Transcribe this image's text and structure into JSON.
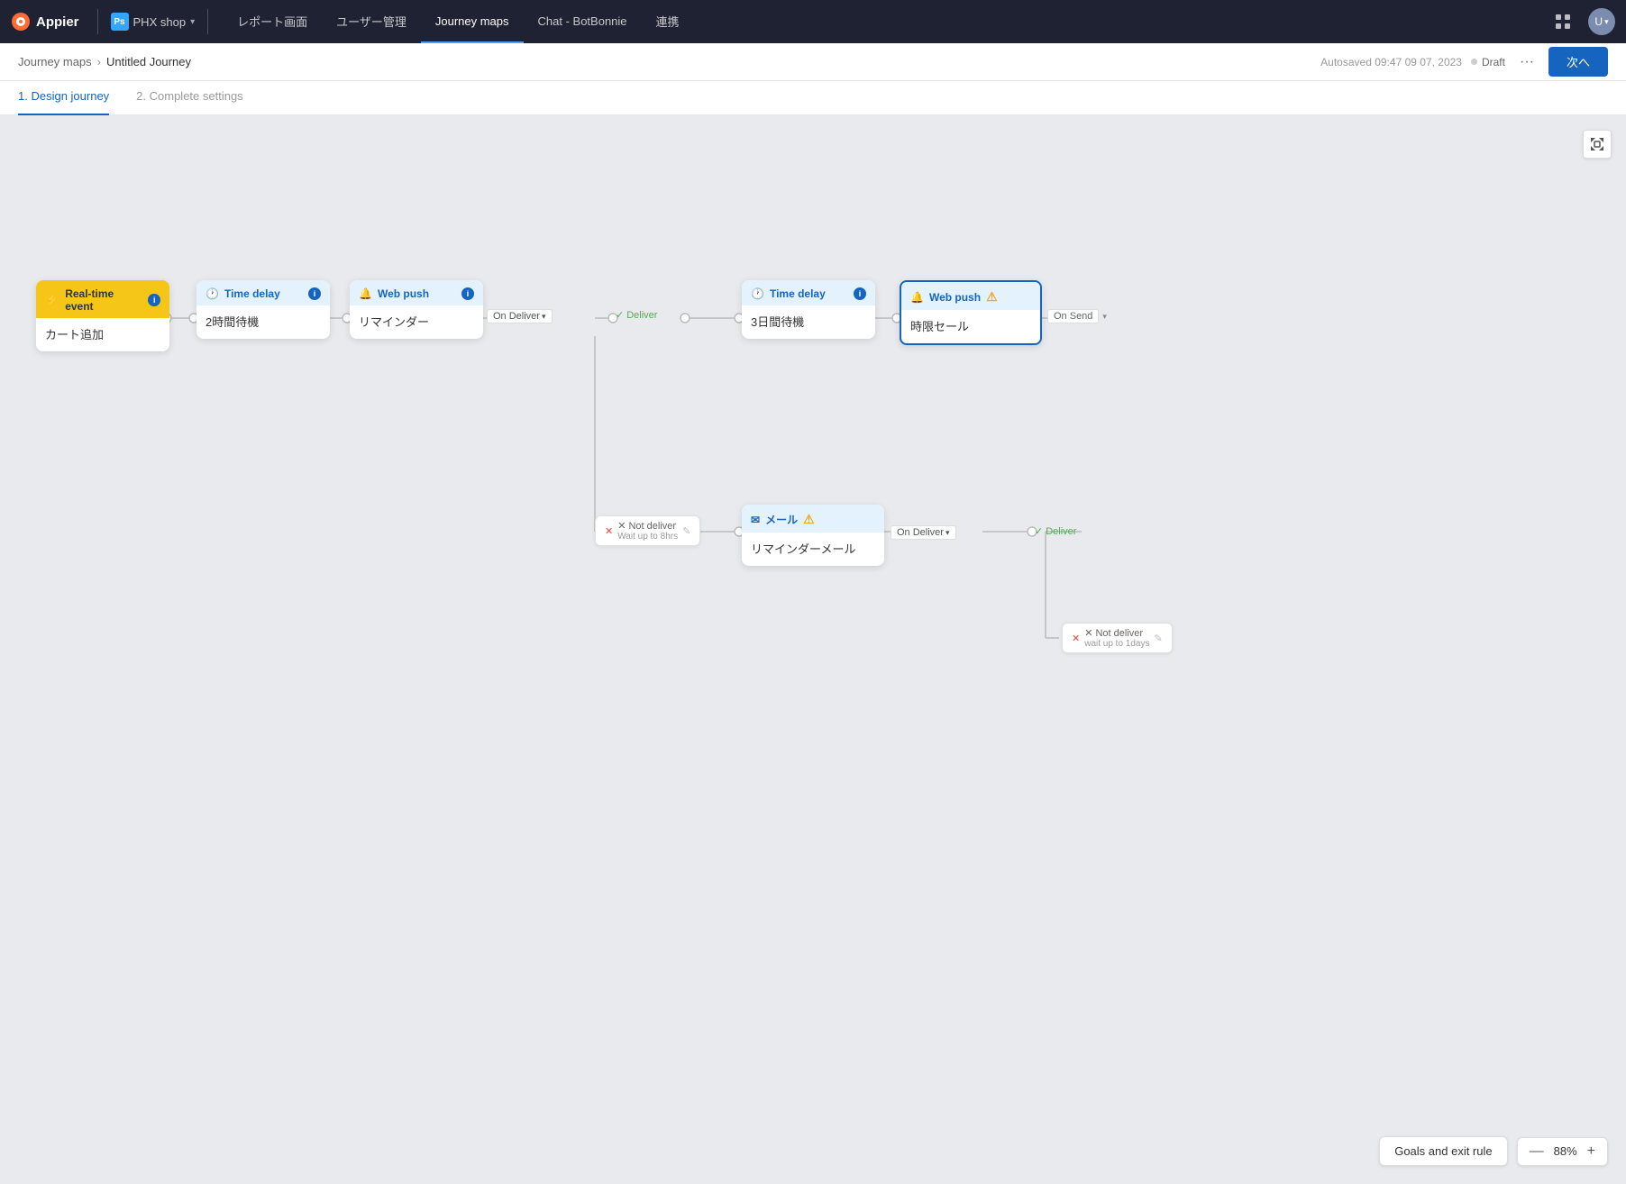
{
  "app": {
    "logo_text": "Appier",
    "workspace": "PHX shop",
    "nav_items": [
      {
        "label": "レポート画面",
        "active": false
      },
      {
        "label": "ユーザー管理",
        "active": false
      },
      {
        "label": "Journey maps",
        "active": true
      },
      {
        "label": "Chat - BotBonnie",
        "active": false
      },
      {
        "label": "連携",
        "active": false
      }
    ]
  },
  "header": {
    "breadcrumb_parent": "Journey maps",
    "breadcrumb_current": "Untitled Journey",
    "status_label": "Draft",
    "autosaved": "Autosaved  09:47 09 07, 2023",
    "next_btn": "次へ"
  },
  "steps": [
    {
      "label": "1. Design journey",
      "active": true
    },
    {
      "label": "2. Complete settings",
      "active": false
    }
  ],
  "nodes": {
    "real_time_event": {
      "header": "Real-time event",
      "body": "カート追加",
      "type": "yellow"
    },
    "time_delay_1": {
      "header": "Time delay",
      "body": "2時間待機",
      "type": "blue"
    },
    "web_push_1": {
      "header": "Web push",
      "body": "リマインダー",
      "type": "blue"
    },
    "time_delay_2": {
      "header": "Time delay",
      "body": "3日間待機",
      "type": "blue"
    },
    "web_push_2": {
      "header": "Web push",
      "body": "時限セール",
      "type": "blue",
      "selected": true,
      "warning": true
    },
    "email_1": {
      "header": "メール",
      "body": "リマインダーメール",
      "type": "blue",
      "warning": true
    }
  },
  "connectors": {
    "on_deliver_1": "On Deliver",
    "deliver_1": "Deliver",
    "on_deliver_2": "On Deliver",
    "deliver_2": "Deliver",
    "not_deliver_1": "✕ Not deliver",
    "not_deliver_1_sub": "Wait up to 8hrs",
    "not_deliver_2": "✕ Not deliver",
    "not_deliver_2_sub": "wait up to 1days",
    "on_send": "On Send"
  },
  "bottom": {
    "goals_label": "Goals and exit rule",
    "zoom_level": "88%",
    "zoom_minus": "—",
    "zoom_plus": "+"
  }
}
